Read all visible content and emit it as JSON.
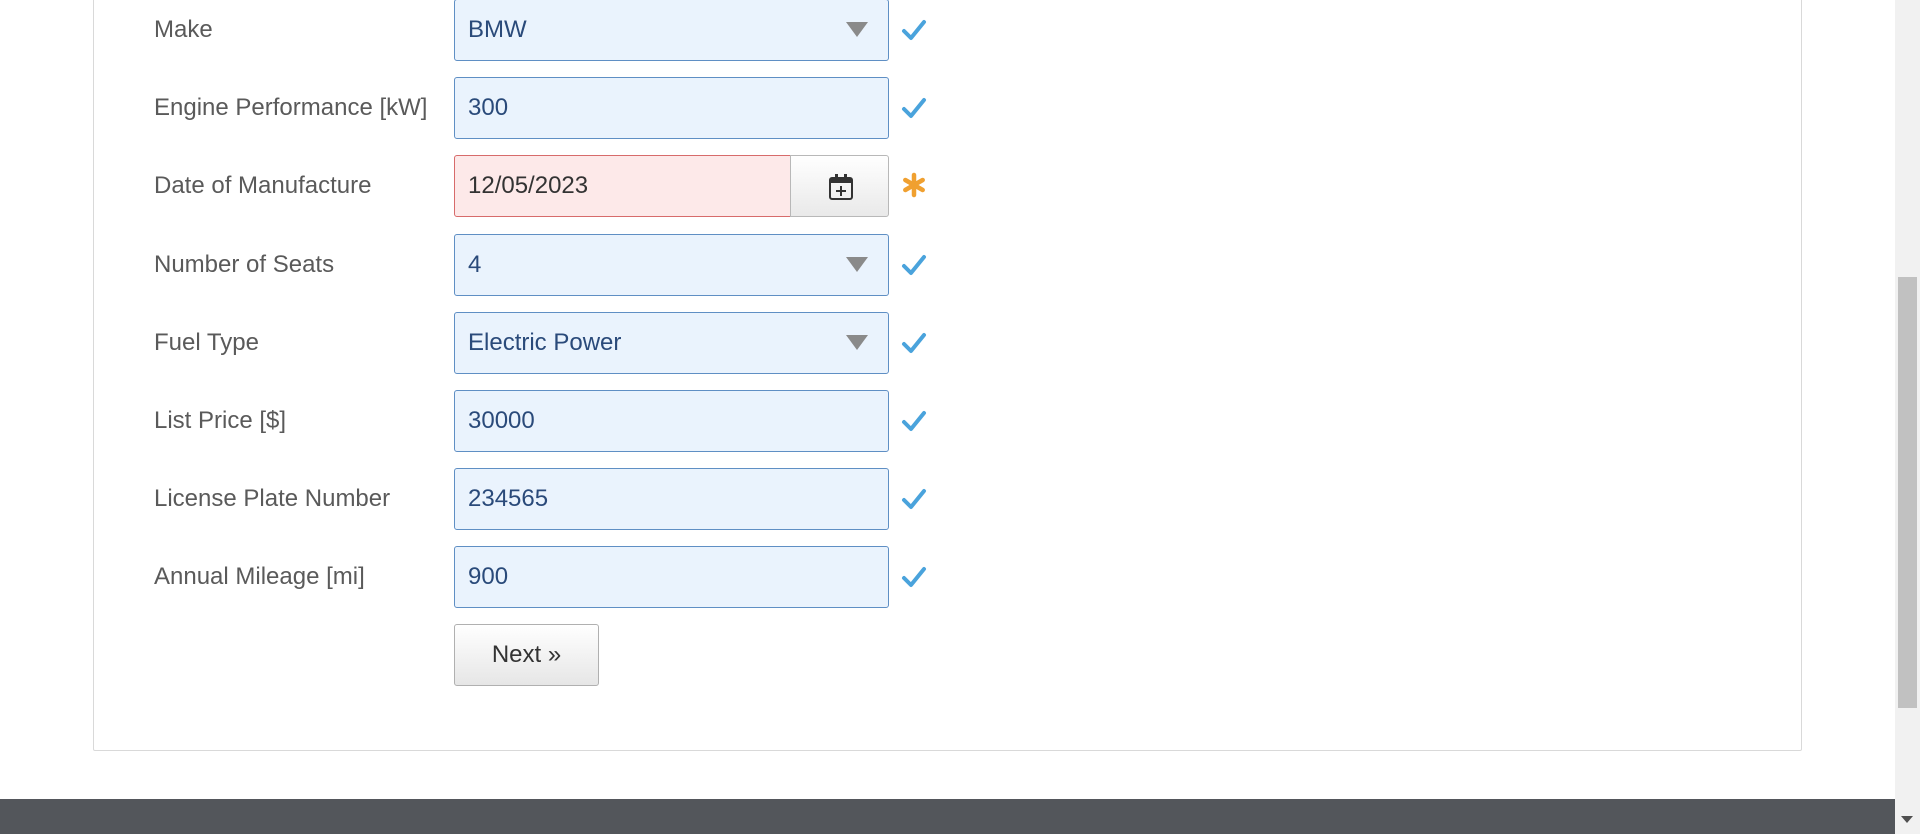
{
  "form": {
    "rows": [
      {
        "label": "Make",
        "value": "BMW",
        "type": "select",
        "status": "valid"
      },
      {
        "label": "Engine Performance [kW]",
        "value": "300",
        "type": "text",
        "status": "valid"
      },
      {
        "label": "Date of Manufacture",
        "value": "12/05/2023",
        "type": "date",
        "status": "required"
      },
      {
        "label": "Number of Seats",
        "value": "4",
        "type": "select",
        "status": "valid"
      },
      {
        "label": "Fuel Type",
        "value": "Electric Power",
        "type": "select",
        "status": "valid"
      },
      {
        "label": "List Price [$]",
        "value": "30000",
        "type": "text",
        "status": "valid"
      },
      {
        "label": "License Plate Number",
        "value": "234565",
        "type": "text",
        "status": "valid"
      },
      {
        "label": "Annual Mileage [mi]",
        "value": "900",
        "type": "text",
        "status": "valid"
      }
    ],
    "next_label": "Next »"
  },
  "icons": {
    "valid": "checkmark-icon",
    "required": "asterisk-icon",
    "calendar": "calendar-icon",
    "dropdown": "chevron-down-icon"
  },
  "colors": {
    "valid_check": "#4aa3dc",
    "required_star": "#f0a030",
    "field_bg": "#eaf3fd",
    "field_border": "#5f8fc4",
    "error_bg": "#fde9e9",
    "error_border": "#d76b6b",
    "footer_bg": "#53565b"
  }
}
